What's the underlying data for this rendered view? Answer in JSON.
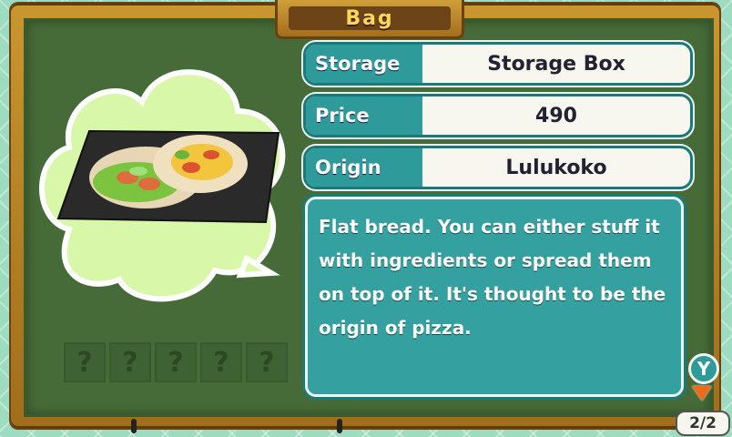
{
  "window": {
    "title": "Bag"
  },
  "item": {
    "rows": [
      {
        "label": "Storage",
        "value": "Storage Box"
      },
      {
        "label": "Price",
        "value": "490"
      },
      {
        "label": "Origin",
        "value": "Lulukoko"
      }
    ],
    "description": "Flat bread. You can either stuff it with ingredients or spread them on top of it. It's thought to be the origin of pizza."
  },
  "quality_slots": [
    "?",
    "?",
    "?",
    "?",
    "?"
  ],
  "controls": {
    "y_button": "Y",
    "page_indicator": "2/2"
  },
  "colors": {
    "board": "#466b38",
    "accent_teal": "#2f9a9a",
    "frame": "#b9862a",
    "bubble": "#d9f7a8"
  },
  "icons": {
    "item_image": "flatbread-icon",
    "page_arrow": "down-arrow-icon"
  }
}
